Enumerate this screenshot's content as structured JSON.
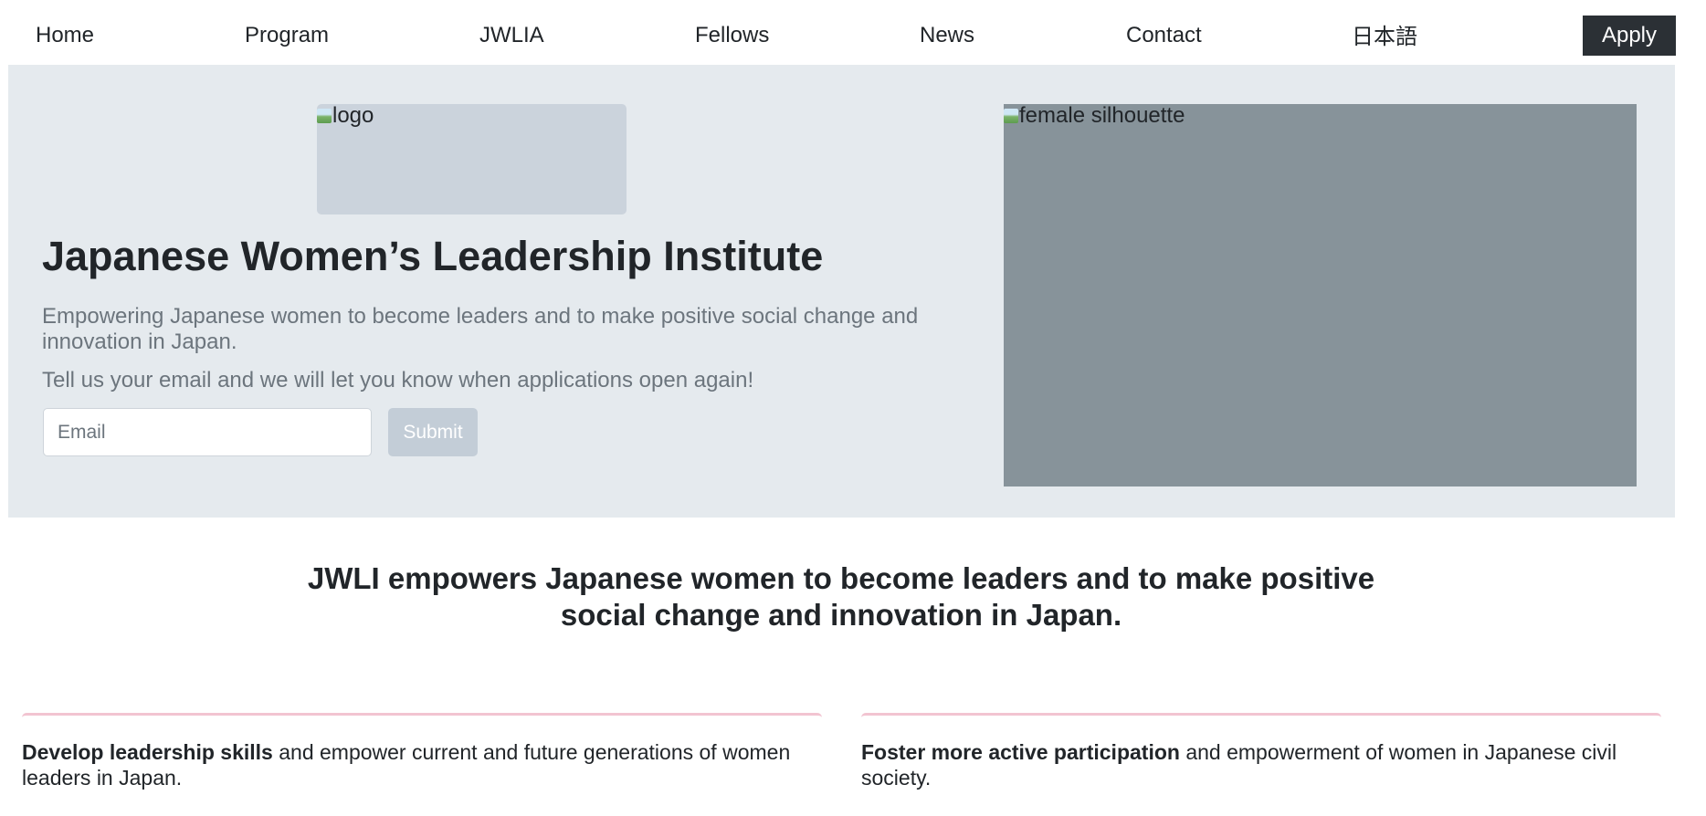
{
  "nav": {
    "items": [
      {
        "label": "Home"
      },
      {
        "label": "Program"
      },
      {
        "label": "JWLIA"
      },
      {
        "label": "Fellows"
      },
      {
        "label": "News"
      },
      {
        "label": "Contact"
      },
      {
        "label": "日本語"
      }
    ],
    "apply_label": "Apply"
  },
  "hero": {
    "logo_alt": "logo",
    "title": "Japanese Women’s Leadership Institute",
    "lead": "Empowering Japanese women to become leaders and to make positive social change and innovation in Japan.",
    "note": "Tell us your email and we will let you know when applications open again!",
    "email_placeholder": "Email",
    "email_value": "",
    "submit_label": "Submit",
    "image_alt": "female silhouette"
  },
  "mission": {
    "line1": "JWLI empowers Japanese women to become leaders and to make positive",
    "line2": "social change and innovation in Japan."
  },
  "features": [
    {
      "bold": "Develop leadership skills",
      "text": " and empower current and future generations of women leaders in Japan."
    },
    {
      "bold": "Foster more active participation",
      "text": " and empowerment of women in Japanese civil society."
    }
  ],
  "colors": {
    "hero_bg": "#e5eaee",
    "apply_bg": "#2b3035",
    "card_accent": "#f2c4d1",
    "submit_bg": "#c3cdd7",
    "silhouette_bg": "#87939a"
  }
}
